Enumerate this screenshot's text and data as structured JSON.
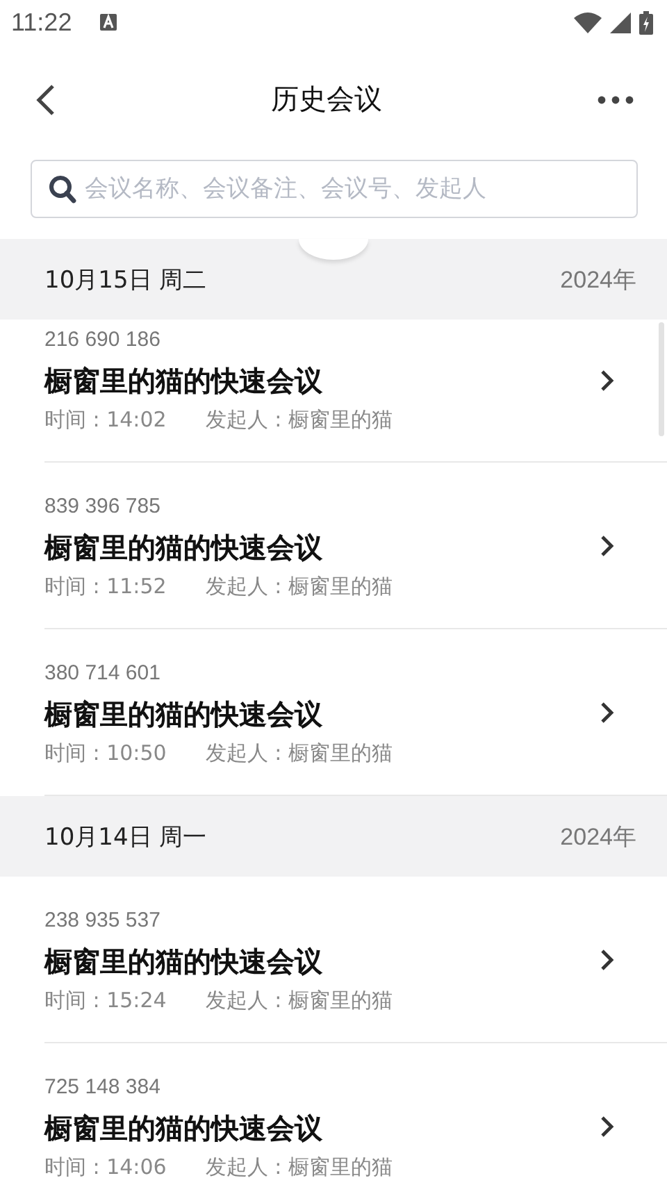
{
  "status_bar": {
    "time": "11:22"
  },
  "header": {
    "title": "历史会议"
  },
  "search": {
    "placeholder": "会议名称、会议备注、会议号、发起人"
  },
  "groups": [
    {
      "date": "10月15日 周二",
      "year": "2024年",
      "meetings": [
        {
          "number": "216 690 186",
          "title": "橱窗里的猫的快速会议",
          "time": "时间 : 14:02",
          "host": "发起人 : 橱窗里的猫"
        },
        {
          "number": "839 396 785",
          "title": "橱窗里的猫的快速会议",
          "time": "时间 : 11:52",
          "host": "发起人 : 橱窗里的猫"
        },
        {
          "number": "380 714 601",
          "title": "橱窗里的猫的快速会议",
          "time": "时间 : 10:50",
          "host": "发起人 : 橱窗里的猫"
        }
      ]
    },
    {
      "date": "10月14日 周一",
      "year": "2024年",
      "meetings": [
        {
          "number": "238 935 537",
          "title": "橱窗里的猫的快速会议",
          "time": "时间 : 15:24",
          "host": "发起人 : 橱窗里的猫"
        },
        {
          "number": "725 148 384",
          "title": "橱窗里的猫的快速会议",
          "time": "时间 : 14:06",
          "host": "发起人 : 橱窗里的猫"
        }
      ]
    }
  ]
}
